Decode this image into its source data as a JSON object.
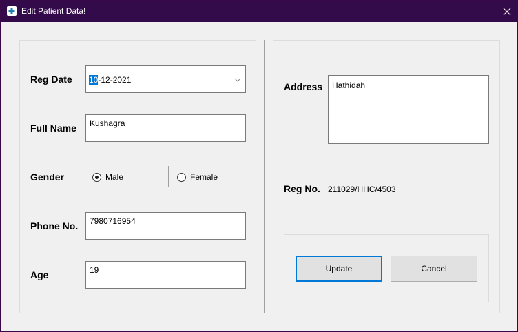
{
  "window": {
    "title": "Edit Patient Data!",
    "close_glyph": "✕"
  },
  "form": {
    "reg_date": {
      "label": "Reg Date",
      "value_highlight": "10",
      "value_rest": "-12-2021"
    },
    "full_name": {
      "label": "Full Name",
      "value": "Kushagra"
    },
    "gender": {
      "label": "Gender",
      "options": [
        "Male",
        "Female"
      ],
      "selected": "Male"
    },
    "phone": {
      "label": "Phone No.",
      "value": "7980716954"
    },
    "age": {
      "label": "Age",
      "value": "19"
    }
  },
  "right": {
    "address": {
      "label": "Address",
      "value": "Hathidah"
    },
    "reg_no": {
      "label": "Reg No.",
      "value": "211029/HHC/4503"
    }
  },
  "buttons": {
    "update": "Update",
    "cancel": "Cancel"
  },
  "colors": {
    "titlebar": "#330a4a",
    "accent": "#0078d7",
    "background": "#f0f0f0"
  }
}
